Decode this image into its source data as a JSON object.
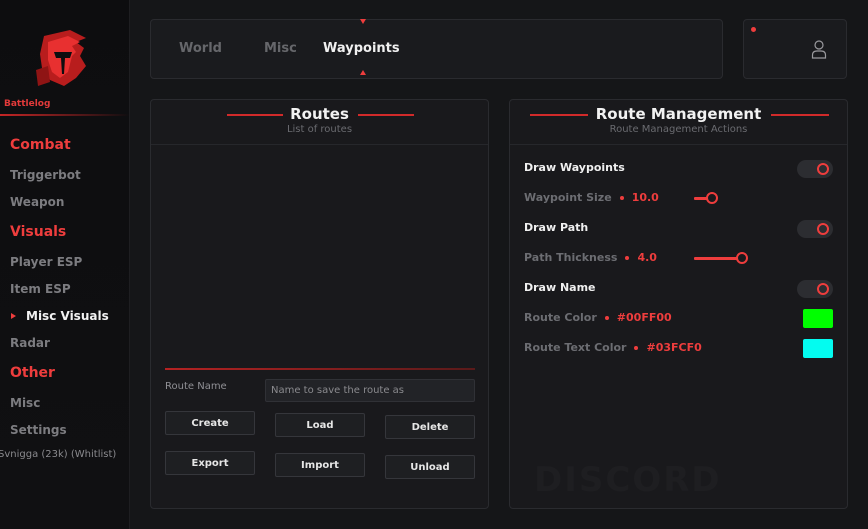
{
  "brand": {
    "name": "Battlelog",
    "accent": "#ee3d3d"
  },
  "sidebar": {
    "sections": [
      {
        "title": "Combat",
        "items": [
          "Triggerbot",
          "Weapon"
        ]
      },
      {
        "title": "Visuals",
        "items": [
          "Player ESP",
          "Item ESP",
          "Misc Visuals",
          "Radar"
        ]
      },
      {
        "title": "Other",
        "items": [
          "Misc",
          "Settings"
        ]
      }
    ],
    "active_item": "Misc Visuals",
    "user_status": "Svnigga (23k) (Whitlist)"
  },
  "tabs": [
    {
      "label": "World"
    },
    {
      "label": "Misc"
    },
    {
      "label": "Waypoints"
    }
  ],
  "active_tab": "Waypoints",
  "routes_panel": {
    "title": "Routes",
    "subtitle": "List of routes",
    "route_name_label": "Route Name",
    "route_name_placeholder": "Name to save the route as",
    "buttons": {
      "create": "Create",
      "load": "Load",
      "delete": "Delete",
      "export": "Export",
      "import": "Import",
      "unload": "Unload"
    }
  },
  "route_management": {
    "title": "Route Management",
    "subtitle": "Route Management Actions",
    "draw_waypoints": {
      "label": "Draw Waypoints",
      "enabled": true
    },
    "waypoint_size": {
      "label": "Waypoint Size",
      "value": "10.0",
      "fraction": 0.25
    },
    "draw_path": {
      "label": "Draw Path",
      "enabled": true
    },
    "path_thickness": {
      "label": "Path Thickness",
      "value": "4.0",
      "fraction": 0.87
    },
    "draw_name": {
      "label": "Draw Name",
      "enabled": true
    },
    "route_color": {
      "label": "Route Color",
      "value": "#00FF00",
      "swatch": "#00ff00"
    },
    "route_text_color": {
      "label": "Route Text Color",
      "value": "#03FCF0",
      "swatch": "#03fcf0"
    }
  }
}
